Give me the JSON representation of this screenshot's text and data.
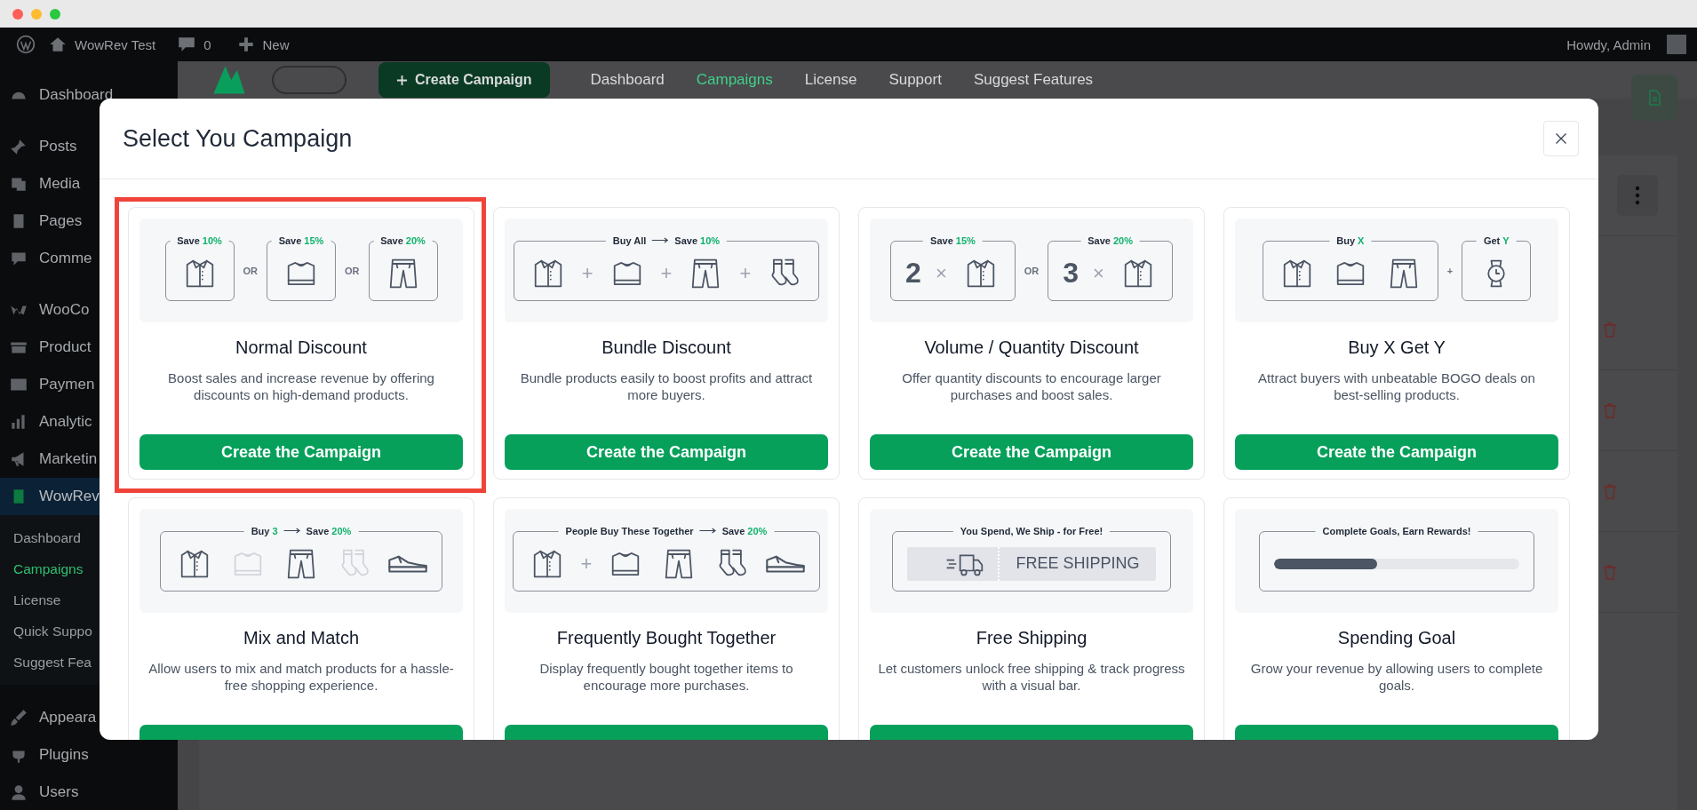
{
  "admin_bar": {
    "site_name": "WowRev Test",
    "comments_count": "0",
    "new_label": "New",
    "greeting": "Howdy, Admin"
  },
  "sidebar": {
    "groups": [
      {
        "items": [
          {
            "label": "Dashboard",
            "current": false
          }
        ]
      },
      {
        "items": [
          {
            "label": "Posts",
            "current": false
          },
          {
            "label": "Media",
            "current": false
          },
          {
            "label": "Pages",
            "current": false
          },
          {
            "label": "Comme",
            "current": false
          }
        ]
      },
      {
        "items": [
          {
            "label": "WooCo",
            "current": false
          },
          {
            "label": "Product",
            "current": false
          },
          {
            "label": "Paymen",
            "current": false
          },
          {
            "label": "Analytic",
            "current": false
          },
          {
            "label": "Marketin",
            "current": false
          },
          {
            "label": "WowRev",
            "current": true,
            "children": [
              {
                "label": "Dashboard",
                "selected": false
              },
              {
                "label": "Campaigns",
                "selected": true
              },
              {
                "label": "License",
                "selected": false
              },
              {
                "label": "Quick Suppo",
                "selected": false
              },
              {
                "label": "Suggest Fea",
                "selected": false
              }
            ]
          }
        ]
      },
      {
        "items": [
          {
            "label": "Appeara",
            "current": false
          },
          {
            "label": "Plugins",
            "current": false
          },
          {
            "label": "Users",
            "current": false
          }
        ]
      }
    ]
  },
  "plugin_header": {
    "create_button": "Create Campaign",
    "nav": [
      {
        "label": "Dashboard",
        "selected": false
      },
      {
        "label": "Campaigns",
        "selected": true
      },
      {
        "label": "License",
        "selected": false
      },
      {
        "label": "Support",
        "selected": false
      },
      {
        "label": "Suggest Features",
        "selected": false
      }
    ]
  },
  "modal": {
    "title": "Select You Campaign",
    "cards": [
      {
        "title": "Normal Discount",
        "description": "Boost sales and increase revenue by offering discounts on high-demand products.",
        "button": "Create the Campaign",
        "highlighted": true,
        "illustration": [
          {
            "kind": "frame",
            "caption": [
              {
                "kind": "text",
                "label": "Save",
                "value": "10%"
              }
            ],
            "content": [
              {
                "kind": "shirt"
              }
            ]
          },
          {
            "kind": "joiner",
            "text": "OR"
          },
          {
            "kind": "frame",
            "caption": [
              {
                "kind": "text",
                "label": "Save",
                "value": "15%"
              }
            ],
            "content": [
              {
                "kind": "sweater"
              }
            ]
          },
          {
            "kind": "joiner",
            "text": "OR"
          },
          {
            "kind": "frame",
            "caption": [
              {
                "kind": "text",
                "label": "Save",
                "value": "20%"
              }
            ],
            "content": [
              {
                "kind": "pants"
              }
            ]
          }
        ]
      },
      {
        "title": "Bundle Discount",
        "description": "Bundle products easily to boost profits and attract more buyers.",
        "button": "Create the Campaign",
        "highlighted": false,
        "illustration": [
          {
            "kind": "frame",
            "caption": [
              {
                "kind": "text",
                "label": "Buy All"
              },
              {
                "kind": "arrow"
              },
              {
                "kind": "text",
                "label": "Save",
                "value": "10%"
              }
            ],
            "content": [
              {
                "kind": "shirt"
              },
              {
                "kind": "plus",
                "text": "+"
              },
              {
                "kind": "sweater"
              },
              {
                "kind": "plus",
                "text": "+"
              },
              {
                "kind": "pants"
              },
              {
                "kind": "plus",
                "text": "+"
              },
              {
                "kind": "socks"
              }
            ]
          }
        ]
      },
      {
        "title": "Volume / Quantity Discount",
        "description": "Offer quantity discounts to encourage larger purchases and boost sales.",
        "button": "Create the Campaign",
        "highlighted": false,
        "illustration": [
          {
            "kind": "frame",
            "caption": [
              {
                "kind": "text",
                "label": "Save",
                "value": "15%"
              }
            ],
            "content": [
              {
                "kind": "number",
                "text": "2"
              },
              {
                "kind": "times",
                "text": "×"
              },
              {
                "kind": "shirt"
              }
            ]
          },
          {
            "kind": "joiner",
            "text": "OR"
          },
          {
            "kind": "frame",
            "caption": [
              {
                "kind": "text",
                "label": "Save",
                "value": "20%"
              }
            ],
            "content": [
              {
                "kind": "number",
                "text": "3"
              },
              {
                "kind": "times",
                "text": "×"
              },
              {
                "kind": "shirt"
              }
            ]
          }
        ]
      },
      {
        "title": "Buy X Get Y",
        "description": "Attract buyers with unbeatable BOGO deals on best-selling products.",
        "button": "Create the Campaign",
        "highlighted": false,
        "illustration": [
          {
            "kind": "frame",
            "caption": [
              {
                "kind": "text",
                "label": "Buy",
                "value": "X"
              }
            ],
            "content": [
              {
                "kind": "shirt"
              },
              {
                "kind": "sweater"
              },
              {
                "kind": "pants"
              }
            ]
          },
          {
            "kind": "joiner",
            "text": "+"
          },
          {
            "kind": "frame",
            "caption": [
              {
                "kind": "text",
                "label": "Get",
                "value": "Y"
              }
            ],
            "content": [
              {
                "kind": "watch"
              }
            ]
          }
        ]
      },
      {
        "title": "Mix and Match",
        "description": "Allow users to mix and match products for a hassle-free shopping experience.",
        "highlighted": false,
        "illustration": [
          {
            "kind": "frame",
            "caption": [
              {
                "kind": "text",
                "label": "Buy",
                "value": "3"
              },
              {
                "kind": "arrow"
              },
              {
                "kind": "text",
                "label": "Save",
                "value": "20%"
              }
            ],
            "content": [
              {
                "kind": "shirt",
                "faded": false
              },
              {
                "kind": "sweater",
                "faded": true
              },
              {
                "kind": "pants",
                "faded": false
              },
              {
                "kind": "socks",
                "faded": true
              },
              {
                "kind": "shoe",
                "faded": false
              }
            ]
          }
        ]
      },
      {
        "title": "Frequently Bought Together",
        "description": "Display frequently bought together items to encourage more purchases.",
        "highlighted": false,
        "illustration": [
          {
            "kind": "frame",
            "caption": [
              {
                "kind": "text",
                "label": "People Buy These Together"
              },
              {
                "kind": "arrow"
              },
              {
                "kind": "text",
                "label": "Save",
                "value": "20%"
              }
            ],
            "content": [
              {
                "kind": "shirt"
              },
              {
                "kind": "plus",
                "text": "+"
              },
              {
                "kind": "sweater"
              },
              {
                "kind": "pants"
              },
              {
                "kind": "socks"
              },
              {
                "kind": "shoe"
              }
            ]
          }
        ]
      },
      {
        "title": "Free Shipping",
        "description": "Let customers unlock free shipping & track progress with a visual bar.",
        "highlighted": false,
        "illustration": [
          {
            "kind": "frame",
            "caption": [
              {
                "kind": "text",
                "label": "You Spend, We Ship - for Free!"
              }
            ],
            "content": [
              {
                "kind": "shipping",
                "text": "FREE SHIPPING"
              }
            ]
          }
        ]
      },
      {
        "title": "Spending Goal",
        "description": "Grow your revenue by allowing users to complete goals.",
        "highlighted": false,
        "illustration": [
          {
            "kind": "frame",
            "caption": [
              {
                "kind": "text",
                "label": "Complete Goals, Earn Rewards!"
              }
            ],
            "content": [
              {
                "kind": "progress",
                "level": 0.42
              }
            ]
          }
        ]
      }
    ]
  }
}
